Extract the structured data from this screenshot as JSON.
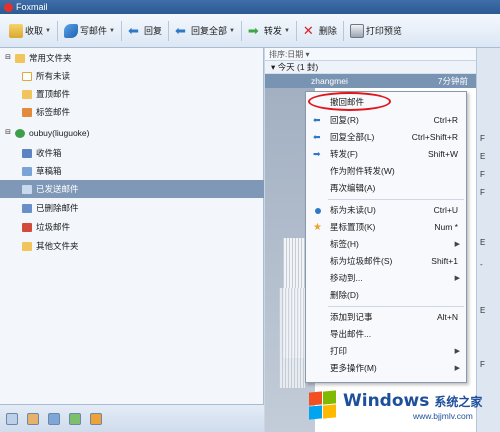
{
  "app": {
    "title": "Foxmail"
  },
  "toolbar": {
    "items": [
      {
        "label": "收取",
        "icon": "receive-icon",
        "has_menu": true
      },
      {
        "label": "写邮件",
        "icon": "write-icon",
        "has_menu": true
      },
      {
        "label": "回复",
        "icon": "reply-icon",
        "has_menu": false
      },
      {
        "label": "回复全部",
        "icon": "reply-all-icon",
        "has_menu": true
      },
      {
        "label": "转发",
        "icon": "forward-icon",
        "has_menu": true
      },
      {
        "label": "删除",
        "icon": "delete-icon",
        "has_menu": false
      },
      {
        "label": "打印预览",
        "icon": "print-icon",
        "has_menu": false
      }
    ]
  },
  "folders": {
    "common_group": "常用文件夹",
    "common": [
      "所有未读",
      "置顶邮件",
      "标签邮件"
    ],
    "account": "oubuy(liuguoke)",
    "account_folders": [
      "收件箱",
      "草稿箱",
      "已发送邮件",
      "已删除邮件",
      "垃圾邮件",
      "其他文件夹"
    ],
    "selected_folder": "已发送邮件"
  },
  "message_list": {
    "sort_label": "排序:日期 ▾",
    "group_label": "今天 (1 封)",
    "selected_from": "zhangmei",
    "selected_time": "7分钟前"
  },
  "right_strip": {
    "labels": [
      "F",
      "E",
      "F",
      "F",
      "E",
      "-",
      "E",
      "F"
    ]
  },
  "context_menu": {
    "items": [
      {
        "label": "撤回邮件",
        "shortcut": "",
        "icon": "",
        "submenu": false,
        "highlighted": true
      },
      {
        "label": "回复(R)",
        "shortcut": "Ctrl+R",
        "icon": "reply-icon",
        "submenu": false
      },
      {
        "label": "回复全部(L)",
        "shortcut": "Ctrl+Shift+R",
        "icon": "reply-all-icon",
        "submenu": false
      },
      {
        "label": "转发(F)",
        "shortcut": "Shift+W",
        "icon": "forward-icon",
        "submenu": false
      },
      {
        "label": "作为附件转发(W)",
        "shortcut": "",
        "icon": "",
        "submenu": false
      },
      {
        "label": "再次编辑(A)",
        "shortcut": "",
        "icon": "",
        "submenu": false
      },
      {
        "label": "标为未读(U)",
        "shortcut": "Ctrl+U",
        "icon": "unread-dot-icon",
        "submenu": false
      },
      {
        "label": "星标置顶(K)",
        "shortcut": "Num *",
        "icon": "star-icon",
        "submenu": false
      },
      {
        "label": "标签(H)",
        "shortcut": "",
        "icon": "",
        "submenu": true
      },
      {
        "label": "标为垃圾邮件(S)",
        "shortcut": "Shift+1",
        "icon": "",
        "submenu": false
      },
      {
        "label": "移动到...",
        "shortcut": "",
        "icon": "",
        "submenu": true
      },
      {
        "label": "删除(D)",
        "shortcut": "",
        "icon": "",
        "submenu": false
      },
      {
        "label": "添加到记事",
        "shortcut": "Alt+N",
        "icon": "",
        "submenu": false
      },
      {
        "label": "导出邮件...",
        "shortcut": "",
        "icon": "",
        "submenu": false
      },
      {
        "label": "打印",
        "shortcut": "",
        "icon": "",
        "submenu": true
      },
      {
        "label": "更多操作(M)",
        "shortcut": "",
        "icon": "",
        "submenu": true
      }
    ]
  },
  "watermark": {
    "brand": "Windows",
    "cn": "系统之家",
    "url": "www.bjjmlv.com"
  },
  "colors": {
    "accent": "#2c5a93",
    "selection": "#7f98b7",
    "highlight_oval": "#e0161d"
  }
}
